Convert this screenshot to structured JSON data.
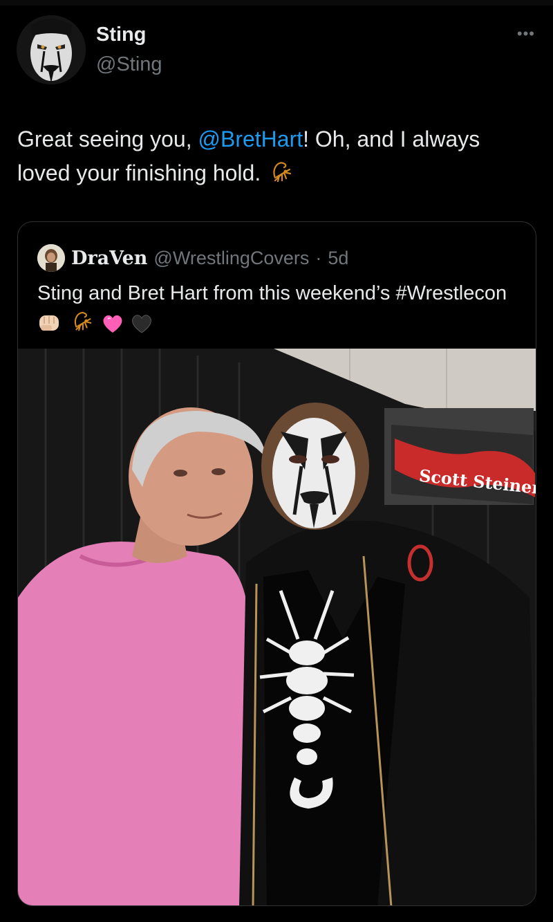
{
  "tweet": {
    "author_name": "Sting",
    "author_handle": "@Sting",
    "more_icon": "more-options-icon",
    "text_before": "Great seeing you, ",
    "mention": "@BretHart",
    "text_after": "! Oh, and I always loved your finishing hold.",
    "emoji": "scorpion-emoji"
  },
  "quote": {
    "author_name": "DraVen",
    "author_handle": "@WrestlingCovers",
    "separator": "·",
    "time": "5d",
    "text": "Sting and Bret Hart from this weekend’s #Wrestlecon",
    "emojis": [
      "fist-emoji",
      "scorpion-emoji",
      "pink-heart-emoji",
      "black-heart-emoji"
    ],
    "photo": {
      "banner_text": "Scott Steiner"
    }
  },
  "colors": {
    "background": "#000000",
    "text": "#e7e9ea",
    "secondary": "#71767b",
    "link": "#1d9bf0",
    "border": "#2f3336"
  }
}
